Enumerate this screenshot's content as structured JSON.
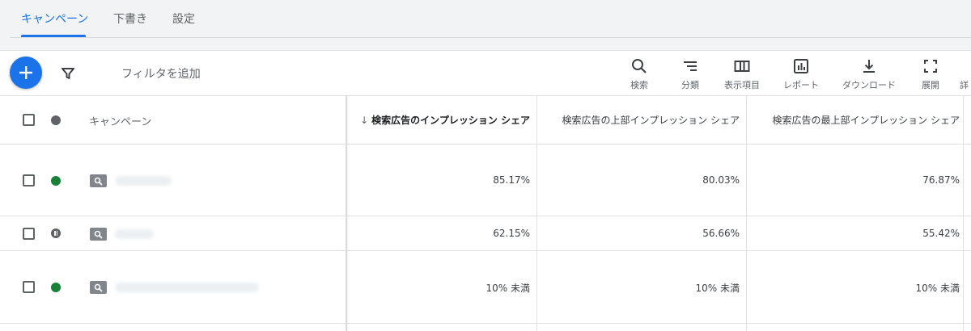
{
  "tabs": [
    {
      "label": "キャンペーン",
      "active": true
    },
    {
      "label": "下書き",
      "active": false
    },
    {
      "label": "設定",
      "active": false
    }
  ],
  "toolbar": {
    "add_button_icon": "plus-icon",
    "filter_icon": "filter-icon",
    "filter_placeholder": "フィルタを追加",
    "tools": [
      {
        "label": "検索",
        "icon": "search-icon"
      },
      {
        "label": "分類",
        "icon": "segment-icon"
      },
      {
        "label": "表示項目",
        "icon": "columns-icon"
      },
      {
        "label": "レポート",
        "icon": "report-icon"
      },
      {
        "label": "ダウンロード",
        "icon": "download-icon"
      },
      {
        "label": "展開",
        "icon": "expand-icon"
      },
      {
        "label": "詳",
        "icon": "more-icon"
      }
    ]
  },
  "table": {
    "columns": [
      {
        "label": "キャンペーン"
      },
      {
        "label": "検索広告のインプレッション シェア",
        "sorted": true,
        "sort_direction": "descending"
      },
      {
        "label": "検索広告の上部インプレッション シェア"
      },
      {
        "label": "検索広告の最上部インプレッション シェア"
      }
    ],
    "rows": [
      {
        "status": "enabled",
        "campaign_type": "search",
        "values": [
          "85.17%",
          "80.03%",
          "76.87%"
        ]
      },
      {
        "status": "paused",
        "campaign_type": "search",
        "values": [
          "62.15%",
          "56.66%",
          "55.42%"
        ]
      },
      {
        "status": "enabled",
        "campaign_type": "search",
        "values": [
          "10% 未満",
          "10% 未満",
          "10% 未満"
        ]
      }
    ]
  },
  "colors": {
    "accent": "#1a73e8",
    "enabled": "#188038",
    "paused": "#5f6368",
    "background": "#f1f3f4"
  }
}
